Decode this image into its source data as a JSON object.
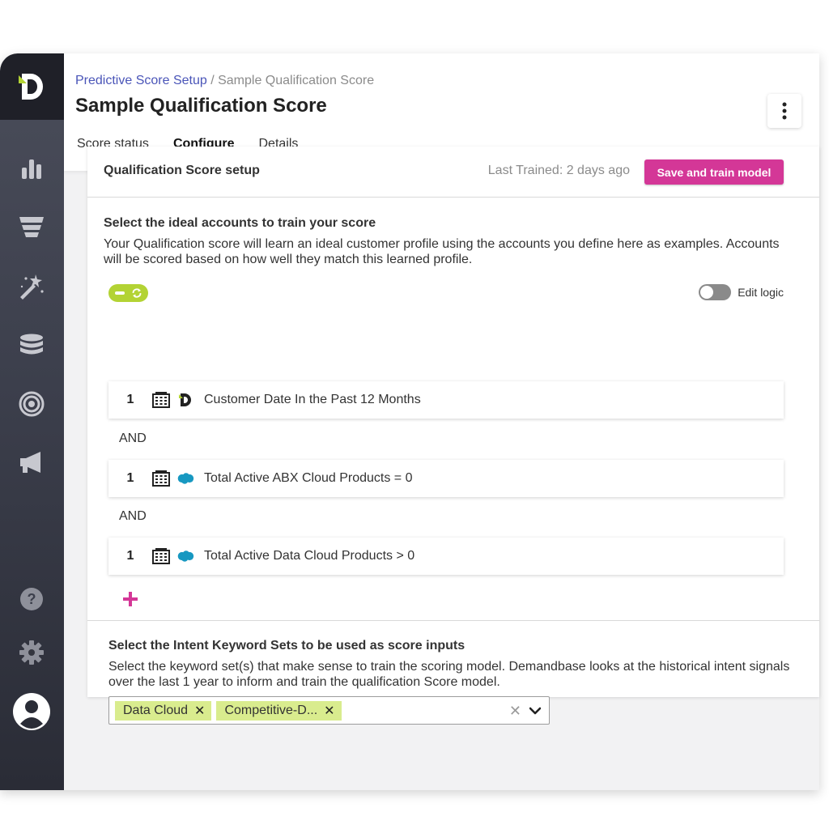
{
  "header": {
    "breadcrumb_link": "Predictive Score Setup",
    "breadcrumb_separator": "/",
    "breadcrumb_current": "Sample Qualification Score",
    "title": "Sample Qualification Score",
    "tabs": [
      {
        "label": "Score status",
        "active": false
      },
      {
        "label": "Configure",
        "active": true
      },
      {
        "label": "Details",
        "active": false
      }
    ]
  },
  "sidebar": {
    "icons": [
      "bar-chart-icon",
      "funnel-icon",
      "magic-wand-icon",
      "database-icon",
      "target-icon",
      "megaphone-icon",
      "help-icon",
      "gear-icon",
      "avatar-icon"
    ]
  },
  "card": {
    "title": "Qualification Score setup",
    "last_trained": "Last Trained: 2 days ago",
    "save_label": "Save and train model",
    "section1_title": "Select the ideal accounts to train your score",
    "section1_desc": "Your Qualification score will learn an ideal customer profile using the accounts you define here as examples. Accounts will be scored based on how well they match this learned profile.",
    "edit_logic_label": "Edit logic",
    "edit_logic_on": false,
    "rules": [
      {
        "num": "1",
        "source_icon": "demandbase-icon",
        "text": "Customer Date In the Past 12 Months"
      },
      {
        "num": "1",
        "source_icon": "salesforce-icon",
        "text": "Total Active ABX Cloud Products = 0"
      },
      {
        "num": "1",
        "source_icon": "salesforce-icon",
        "text": "Total Active Data Cloud Products > 0"
      }
    ],
    "connector": "AND",
    "section2_title": "Select the Intent Keyword Sets to be used as score inputs",
    "section2_desc": "Select the keyword set(s) that make sense to train the scoring model. Demandbase looks at the historical intent signals over the last 1 year to inform and train the qualification Score model.",
    "chips": [
      "Data Cloud",
      "Competitive-D..."
    ],
    "chip_remove": "✕",
    "clear_symbol": "✕"
  },
  "colors": {
    "accent_green": "#b3d334",
    "primary_pink": "#d43797",
    "link_blue": "#4a55b8"
  }
}
